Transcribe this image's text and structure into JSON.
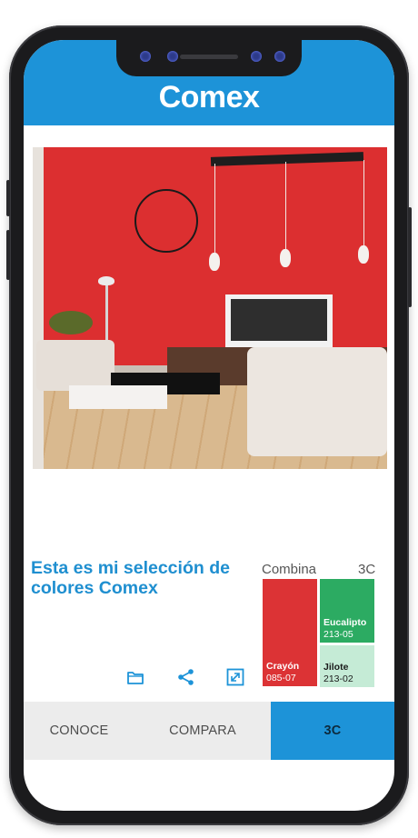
{
  "app": {
    "brand": "Comex"
  },
  "selection": {
    "title": "Esta es mi selección de colores Comex",
    "combine_label": "Combina",
    "scheme_label": "3C",
    "swatches": [
      {
        "name": "Crayón",
        "code": "085-07",
        "color": "#dc3335"
      },
      {
        "name": "Eucalipto",
        "code": "213-05",
        "color": "#2cab62"
      },
      {
        "name": "Jilote",
        "code": "213-02",
        "color": "#c5ebd6"
      }
    ]
  },
  "actions": [
    {
      "icon": "folder-icon"
    },
    {
      "icon": "share-icon"
    },
    {
      "icon": "expand-icon"
    }
  ],
  "tabs": [
    {
      "label": "CONOCE",
      "active": false
    },
    {
      "label": "COMPARA",
      "active": false
    },
    {
      "label": "3C",
      "active": true
    }
  ],
  "colors": {
    "brand_blue": "#1d93d8",
    "wall_red": "#dc2f30",
    "text_blue": "#1f8fd0"
  }
}
